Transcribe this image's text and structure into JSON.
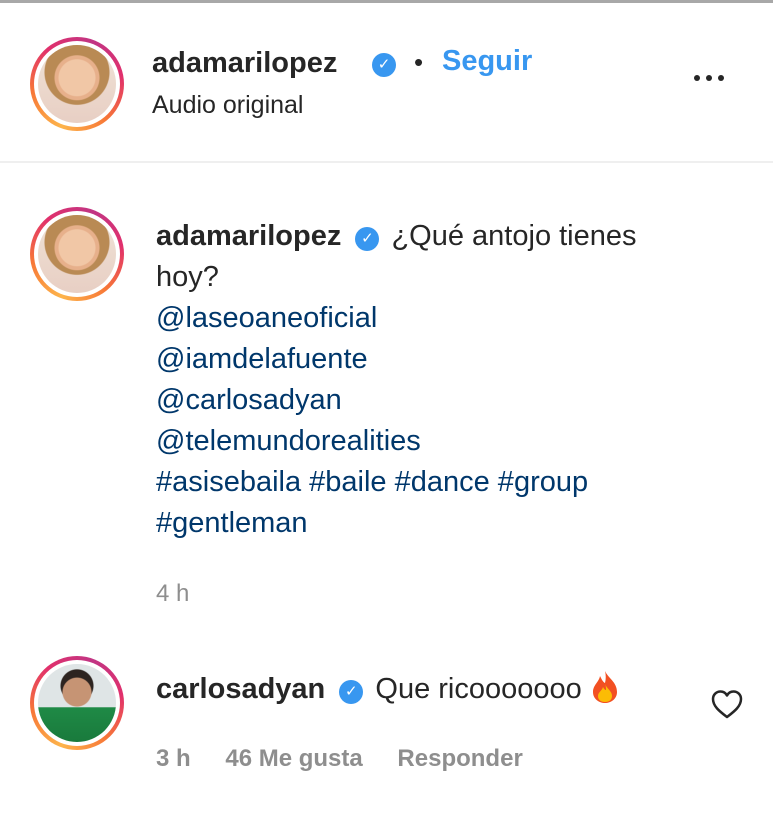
{
  "post_header": {
    "username": "adamarilopez",
    "separator": "•",
    "follow_label": "Seguir",
    "audio_label": "Audio original",
    "more_icon": "more-horizontal-icon"
  },
  "caption": {
    "username": "adamarilopez",
    "text": "¿Qué antojo tienes hoy?",
    "mentions": [
      "@laseoaneoficial",
      "@iamdelafuente",
      "@carlosadyan",
      "@telemundorealities"
    ],
    "hashtags_line1": "#asisebaila #baile #dance #group",
    "hashtags_line2": "#gentleman",
    "time": "4 h"
  },
  "comment": {
    "username": "carlosadyan",
    "text": "Que ricooooooo",
    "emoji_icon": "fire-emoji-icon",
    "time": "3 h",
    "likes": "46 Me gusta",
    "reply_label": "Responder",
    "like_icon": "heart-outline-icon"
  },
  "colors": {
    "link_blue": "#3897f0",
    "mention_blue": "#00376b",
    "verified_blue": "#3897f0",
    "muted_gray": "#8e8e8e"
  }
}
